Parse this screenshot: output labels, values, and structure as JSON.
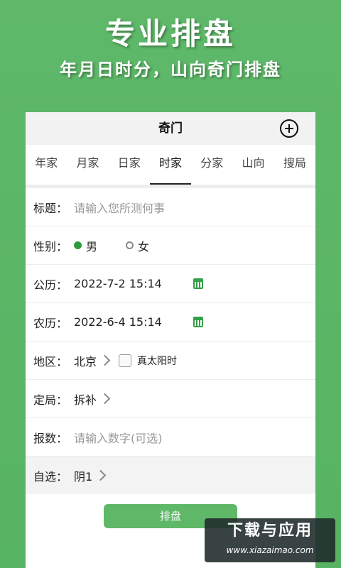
{
  "promo": {
    "title": "专业排盘",
    "subtitle": "年月日时分，山向奇门排盘"
  },
  "header": {
    "title": "奇门",
    "add_icon": "plus-circle-icon"
  },
  "tabs": [
    "年家",
    "月家",
    "日家",
    "时家",
    "分家",
    "山向",
    "搜局"
  ],
  "active_tab": "时家",
  "form": {
    "title": {
      "label": "标题：",
      "placeholder": "请输入您所测何事"
    },
    "gender": {
      "label": "性别：",
      "options": [
        "男",
        "女"
      ],
      "selected": "男"
    },
    "solar": {
      "label": "公历：",
      "value": "2022-7-2 15:14",
      "icon": "calendar-icon"
    },
    "lunar": {
      "label": "农历：",
      "value": "2022-6-4 15:14",
      "icon": "calendar-icon"
    },
    "region": {
      "label": "地区：",
      "value": "北京",
      "checkbox_label": "真太阳时",
      "checked": false
    },
    "ding_ju": {
      "label": "定局：",
      "value": "拆补"
    },
    "bao_shu": {
      "label": "报数：",
      "placeholder": "请输入数字(可选)"
    },
    "zi_xuan": {
      "label": "自选：",
      "value": "阴1"
    }
  },
  "submit_label": "排盘",
  "watermark": {
    "line1": "下载与应用",
    "line2": "www.xiazaimao.com"
  },
  "colors": {
    "accent": "#5fb868",
    "calendar": "#34a04a"
  }
}
